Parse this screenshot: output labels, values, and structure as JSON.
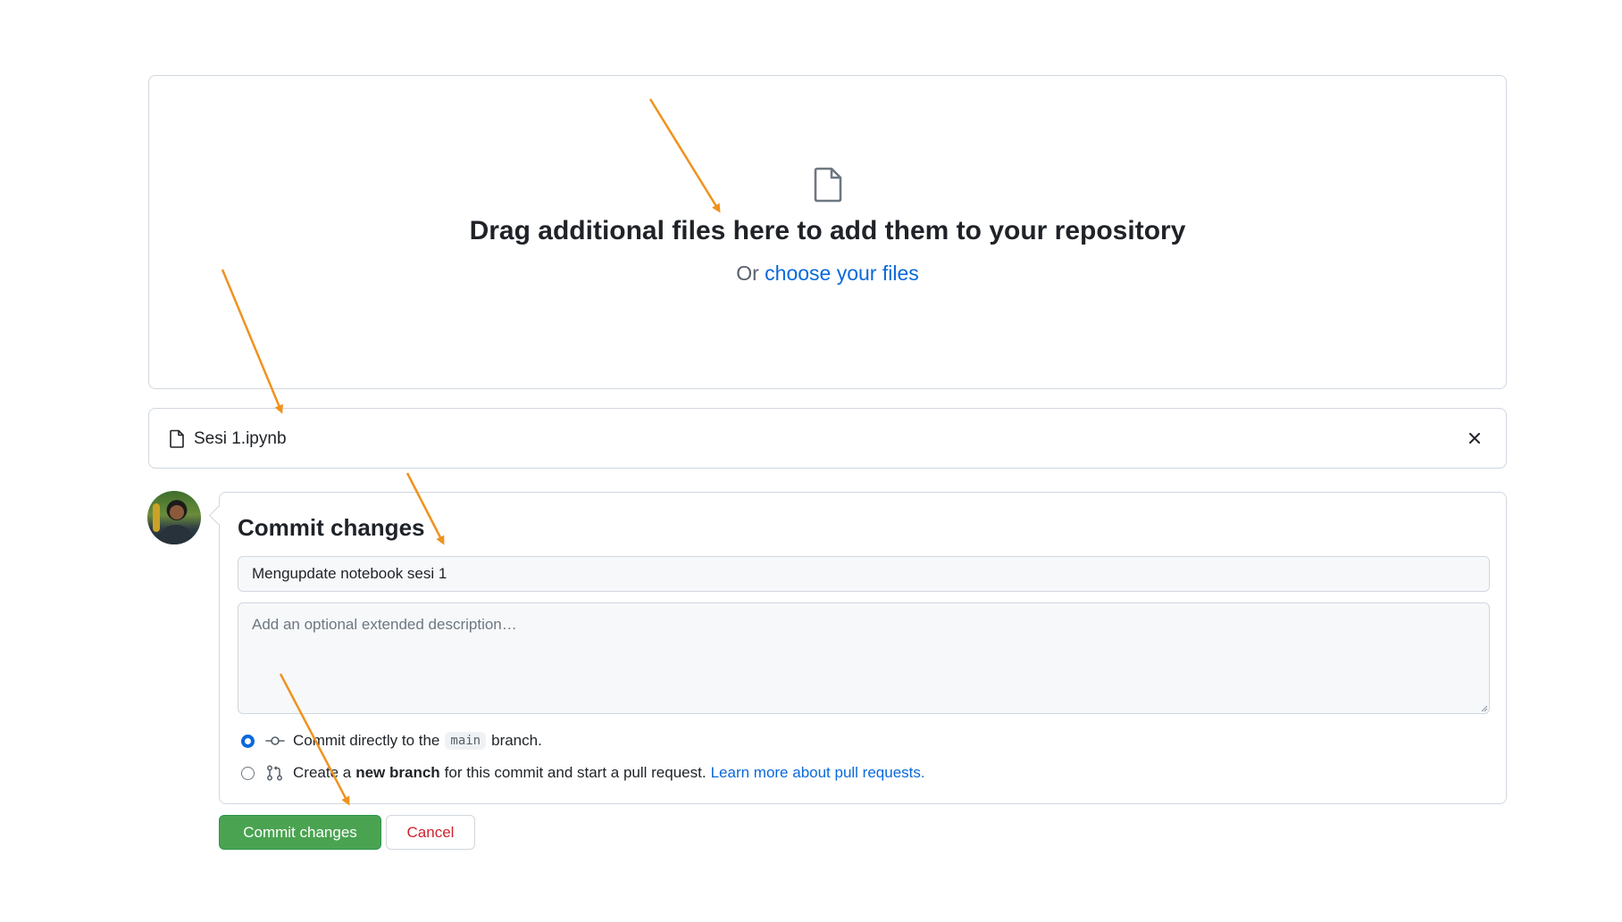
{
  "upload": {
    "title": "Drag additional files here to add them to your repository",
    "or_text": "Or",
    "choose_link": "choose your files"
  },
  "file": {
    "name": "Sesi 1.ipynb",
    "icon": "file-icon"
  },
  "commit": {
    "heading": "Commit changes",
    "summary_value": "Mengupdate notebook sesi 1",
    "description_placeholder": "Add an optional extended description…",
    "option_direct": {
      "before": "Commit directly to the",
      "branch": "main",
      "after": "branch.",
      "selected": true
    },
    "option_new_branch": {
      "before": "Create a",
      "bold": "new branch",
      "after": "for this commit and start a pull request.",
      "link": "Learn more about pull requests.",
      "selected": false
    }
  },
  "buttons": {
    "commit": "Commit changes",
    "cancel": "Cancel"
  },
  "colors": {
    "accent_blue": "#0969da",
    "commit_green": "#4aa351",
    "cancel_red": "#cf222e",
    "annotation_arrow": "#f0921e"
  }
}
